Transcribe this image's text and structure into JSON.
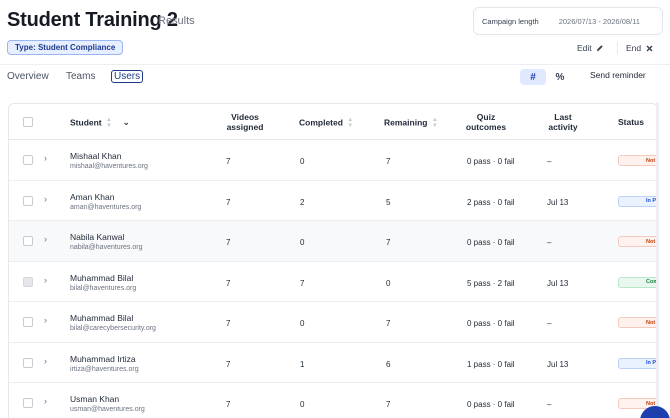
{
  "header": {
    "title": "Student Training 2",
    "subtitle": "Results",
    "campaign_label": "Campaign length",
    "campaign_dates": "2026/07/13 - 2026/08/11",
    "type_pill": "Type: Student Compliance",
    "edit_label": "Edit",
    "end_label": "End"
  },
  "tabs": {
    "overview": "Overview",
    "teams": "Teams",
    "users": "Users"
  },
  "toolbar": {
    "count_toggle": "#",
    "percent_toggle": "%",
    "send_reminder": "Send reminder"
  },
  "table": {
    "headers": {
      "student": "Student",
      "videos_1": "Videos",
      "videos_2": "assigned",
      "completed": "Completed",
      "remaining": "Remaining",
      "quiz_1": "Quiz",
      "quiz_2": "outcomes",
      "last_1": "Last",
      "last_2": "activity",
      "status": "Status"
    },
    "rows": [
      {
        "name": "Mishaal Khan",
        "email": "mishaal@haventures.org",
        "videos": "7",
        "completed": "0",
        "remaining": "7",
        "quiz": "0 pass · 0 fail",
        "last": "–",
        "status": "Not",
        "status_type": "not"
      },
      {
        "name": "Aman Khan",
        "email": "aman@haventures.org",
        "videos": "7",
        "completed": "2",
        "remaining": "5",
        "quiz": "2 pass · 0 fail",
        "last": "Jul 13",
        "status": "In P",
        "status_type": "inp"
      },
      {
        "name": "Nabila Kanwal",
        "email": "nabila@haventures.org",
        "videos": "7",
        "completed": "0",
        "remaining": "7",
        "quiz": "0 pass · 0 fail",
        "last": "–",
        "status": "Not",
        "status_type": "not"
      },
      {
        "name": "Muhammad Bilal",
        "email": "bilal@haventures.org",
        "videos": "7",
        "completed": "7",
        "remaining": "0",
        "quiz": "5 pass · 2 fail",
        "last": "Jul 13",
        "status": "Com",
        "status_type": "com"
      },
      {
        "name": "Muhammad Bilal",
        "email": "bilal@carecybersecurity.org",
        "videos": "7",
        "completed": "0",
        "remaining": "7",
        "quiz": "0 pass · 0 fail",
        "last": "–",
        "status": "Not",
        "status_type": "not"
      },
      {
        "name": "Muhammad Irtiza",
        "email": "irtiza@haventures.org",
        "videos": "7",
        "completed": "1",
        "remaining": "6",
        "quiz": "1 pass · 0 fail",
        "last": "Jul 13",
        "status": "In P",
        "status_type": "inp"
      },
      {
        "name": "Usman Khan",
        "email": "usman@haventures.org",
        "videos": "7",
        "completed": "0",
        "remaining": "7",
        "quiz": "0 pass · 0 fail",
        "last": "–",
        "status": "Not",
        "status_type": "not"
      }
    ]
  },
  "icons": {
    "edit": "pencil-icon",
    "end": "close-icon",
    "expand": "chevron-right-icon",
    "sort": "sort-icon",
    "dropdown": "chevron-down-icon"
  },
  "colors": {
    "accent": "#1e40af",
    "pill_bg": "#e6eeff",
    "not_started": "#c2410c",
    "in_progress": "#1d4ed8",
    "completed": "#15803d"
  }
}
